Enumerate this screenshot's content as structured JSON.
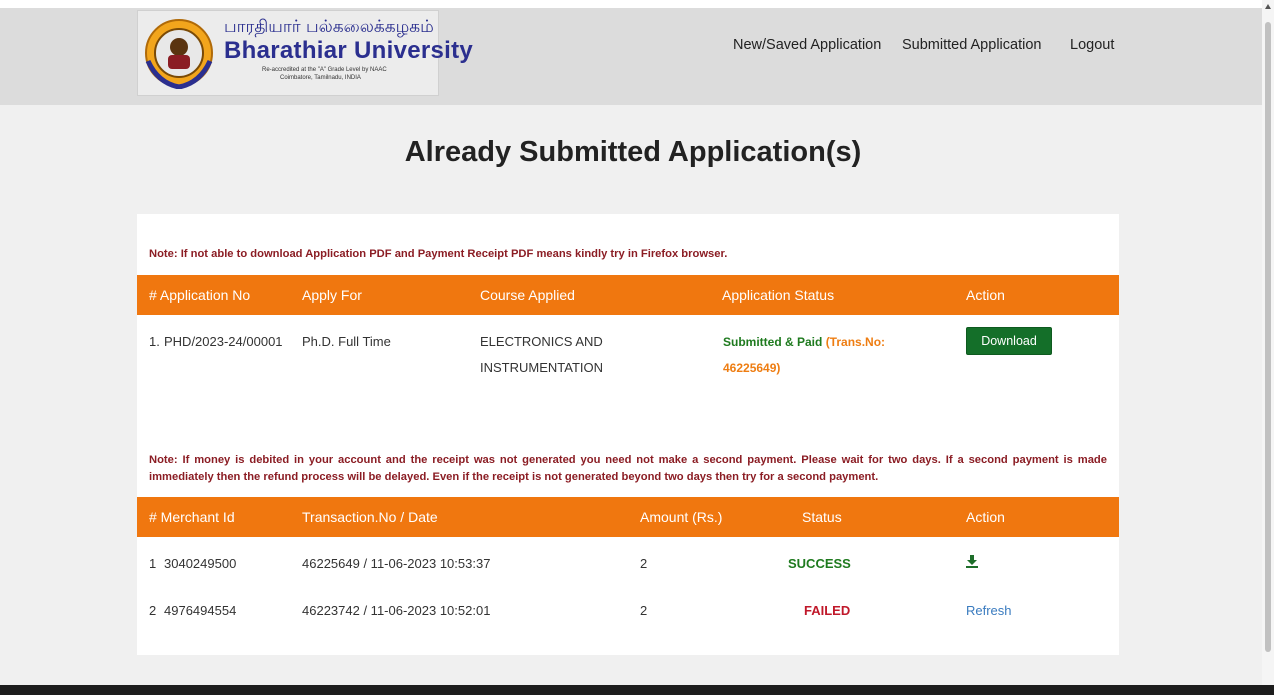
{
  "header": {
    "logo_tamil": "பாரதியார் பல்கலைக்கழகம்",
    "logo_english": "Bharathiar University",
    "logo_sub1": "Re-accredited at the \"A\" Grade Level by NAAC",
    "logo_sub2": "Coimbatore, Tamilnadu, INDIA",
    "nav": [
      "New/Saved Application",
      "Submitted Application",
      "Logout"
    ]
  },
  "page_title": "Already Submitted Application(s)",
  "applications": {
    "note": "Note: If not able to download Application PDF and Payment Receipt PDF means kindly try in Firefox browser.",
    "columns": [
      "# Application No",
      "Apply For",
      "Course Applied",
      "Application Status",
      "Action"
    ],
    "rows": [
      {
        "index": "1.",
        "application_no": "PHD/2023-24/00001",
        "apply_for": "Ph.D.  Full Time",
        "course_line1": "ELECTRONICS AND",
        "course_line2": "INSTRUMENTATION",
        "status_main": "Submitted & Paid",
        "status_trans": "(Trans.No:",
        "status_trans_no": "46225649)",
        "action_label": "Download"
      }
    ]
  },
  "payments": {
    "note": "Note: If money is debited in your account and the receipt was not generated you need not make a second payment. Please wait for two days. If a second payment is made immediately then the refund process will be delayed. Even if the receipt is not generated beyond two days then try for a second payment.",
    "columns": [
      "# Merchant Id",
      "Transaction.No / Date",
      "Amount (Rs.)",
      "Status",
      "Action"
    ],
    "rows": [
      {
        "index": "1",
        "merchant_id": "3040249500",
        "transaction": "46225649 / 11-06-2023 10:53:37",
        "amount": "2",
        "status": "SUCCESS",
        "action": "download-icon"
      },
      {
        "index": "2",
        "merchant_id": "4976494554",
        "transaction": "46223742 / 11-06-2023 10:52:01",
        "amount": "2",
        "status": "FAILED",
        "action": "Refresh"
      }
    ]
  },
  "colors": {
    "header_bg": "#dcdcdc",
    "table_header": "#f0770f",
    "note_text": "#8b1d24",
    "success": "#1e7a1e",
    "failed": "#c0182a",
    "download_button": "#146f29",
    "link": "#3a7bbf"
  }
}
